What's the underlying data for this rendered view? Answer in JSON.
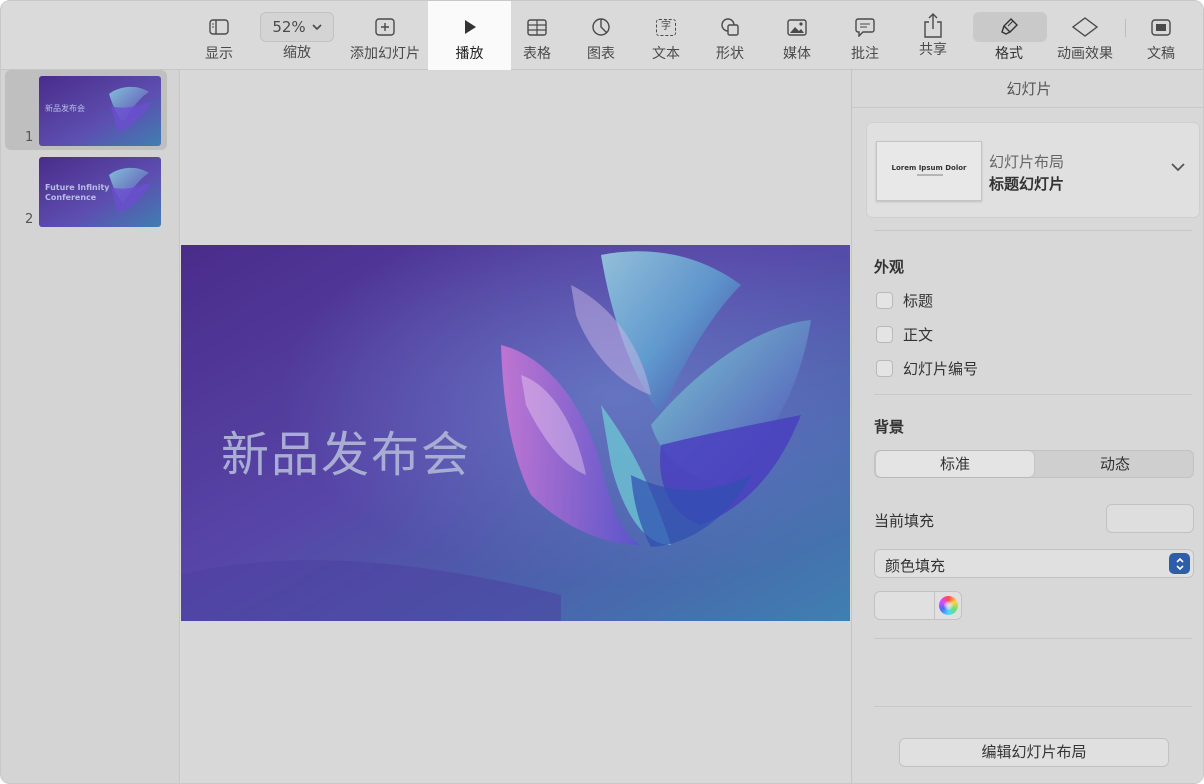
{
  "toolbar": {
    "items": [
      {
        "label": "显示",
        "icon": "sidebar-icon"
      },
      {
        "label": "缩放",
        "value": "52%",
        "icon": "chevron-down-icon"
      },
      {
        "label": "添加幻灯片",
        "icon": "plus-square-icon"
      },
      {
        "label": "播放",
        "icon": "play-icon"
      },
      {
        "label": "表格",
        "icon": "table-icon"
      },
      {
        "label": "图表",
        "icon": "chart-icon"
      },
      {
        "label": "文本",
        "icon": "text-box-icon",
        "glyph": "字"
      },
      {
        "label": "形状",
        "icon": "shape-icon"
      },
      {
        "label": "媒体",
        "icon": "media-icon"
      },
      {
        "label": "批注",
        "icon": "comment-icon"
      },
      {
        "label": "共享",
        "icon": "share-icon"
      },
      {
        "label": "格式",
        "icon": "paintbrush-icon"
      },
      {
        "label": "动画效果",
        "icon": "animate-diamond-icon"
      },
      {
        "label": "文稿",
        "icon": "document-icon"
      }
    ]
  },
  "navigator": {
    "slides": [
      {
        "number": "1",
        "title": "新品发布会",
        "selected": true
      },
      {
        "number": "2",
        "title_lines": [
          "Future Infinity",
          "Conference"
        ],
        "selected": false
      }
    ]
  },
  "canvas": {
    "slide_title": "新品发布会"
  },
  "inspector": {
    "title": "幻灯片",
    "layout": {
      "caption": "幻灯片布局",
      "name": "标题幻灯片",
      "thumb_text": "Lorem Ipsum Dolor"
    },
    "appearance": {
      "title": "外观",
      "options": [
        "标题",
        "正文",
        "幻灯片编号"
      ]
    },
    "background": {
      "title": "背景",
      "segments": [
        "标准",
        "动态"
      ],
      "current_fill_label": "当前填充",
      "fill_type": "颜色填充"
    },
    "edit_layout_button": "编辑幻灯片布局"
  },
  "colors": {
    "accent": "#2e5ea8",
    "slide_bg_start": "#4a2c8a",
    "slide_bg_end": "#3f7fb0",
    "slide_title": "#a9acd3"
  }
}
